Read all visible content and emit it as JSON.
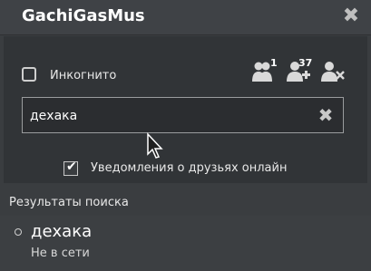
{
  "window": {
    "title": "GachiGasMus"
  },
  "controls": {
    "incognito_label": "Инкогнито",
    "friends_count": "1",
    "add_friend_count": "37"
  },
  "search": {
    "value": "дехака"
  },
  "notifications": {
    "label": "Уведомления о друзьях онлайн",
    "checked": true
  },
  "results": {
    "title": "Результаты поиска",
    "items": [
      {
        "name": "дехака",
        "status": "Не в сети"
      }
    ]
  },
  "icons": {
    "close": "close-icon",
    "friends": "friends-icon",
    "add_friend": "add-friend-icon",
    "remove_friend": "remove-friend-icon",
    "clear": "clear-icon",
    "check": "check-icon"
  }
}
